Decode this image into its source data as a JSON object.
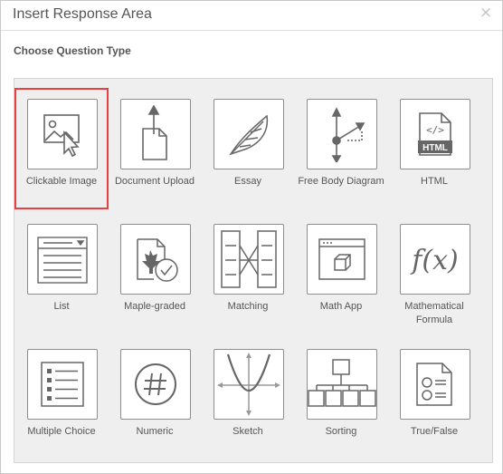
{
  "dialog": {
    "title": "Insert Response Area",
    "close_glyph": "×",
    "section_title": "Choose Question Type"
  },
  "tiles": [
    {
      "label": "Clickable Image",
      "icon": "clickable-image-icon",
      "selected": true
    },
    {
      "label": "Document Upload",
      "icon": "document-upload-icon"
    },
    {
      "label": "Essay",
      "icon": "feather-icon"
    },
    {
      "label": "Free Body Diagram",
      "icon": "free-body-diagram-icon"
    },
    {
      "label": "HTML",
      "icon": "html-icon"
    },
    {
      "label": "List",
      "icon": "list-dropdown-icon"
    },
    {
      "label": "Maple-graded",
      "icon": "maple-leaf-check-icon"
    },
    {
      "label": "Matching",
      "icon": "matching-icon"
    },
    {
      "label": "Math App",
      "icon": "math-app-icon"
    },
    {
      "label": "Mathematical Formula",
      "icon": "fx-icon"
    },
    {
      "label": "Multiple Choice",
      "icon": "multiple-choice-icon"
    },
    {
      "label": "Numeric",
      "icon": "hash-icon"
    },
    {
      "label": "Sketch",
      "icon": "sketch-graph-icon"
    },
    {
      "label": "Sorting",
      "icon": "sorting-icon"
    },
    {
      "label": "True/False",
      "icon": "true-false-icon"
    }
  ],
  "colors": {
    "selected_outline": "#e84040",
    "icon_stroke": "#666666",
    "panel_bg": "#efefef"
  }
}
